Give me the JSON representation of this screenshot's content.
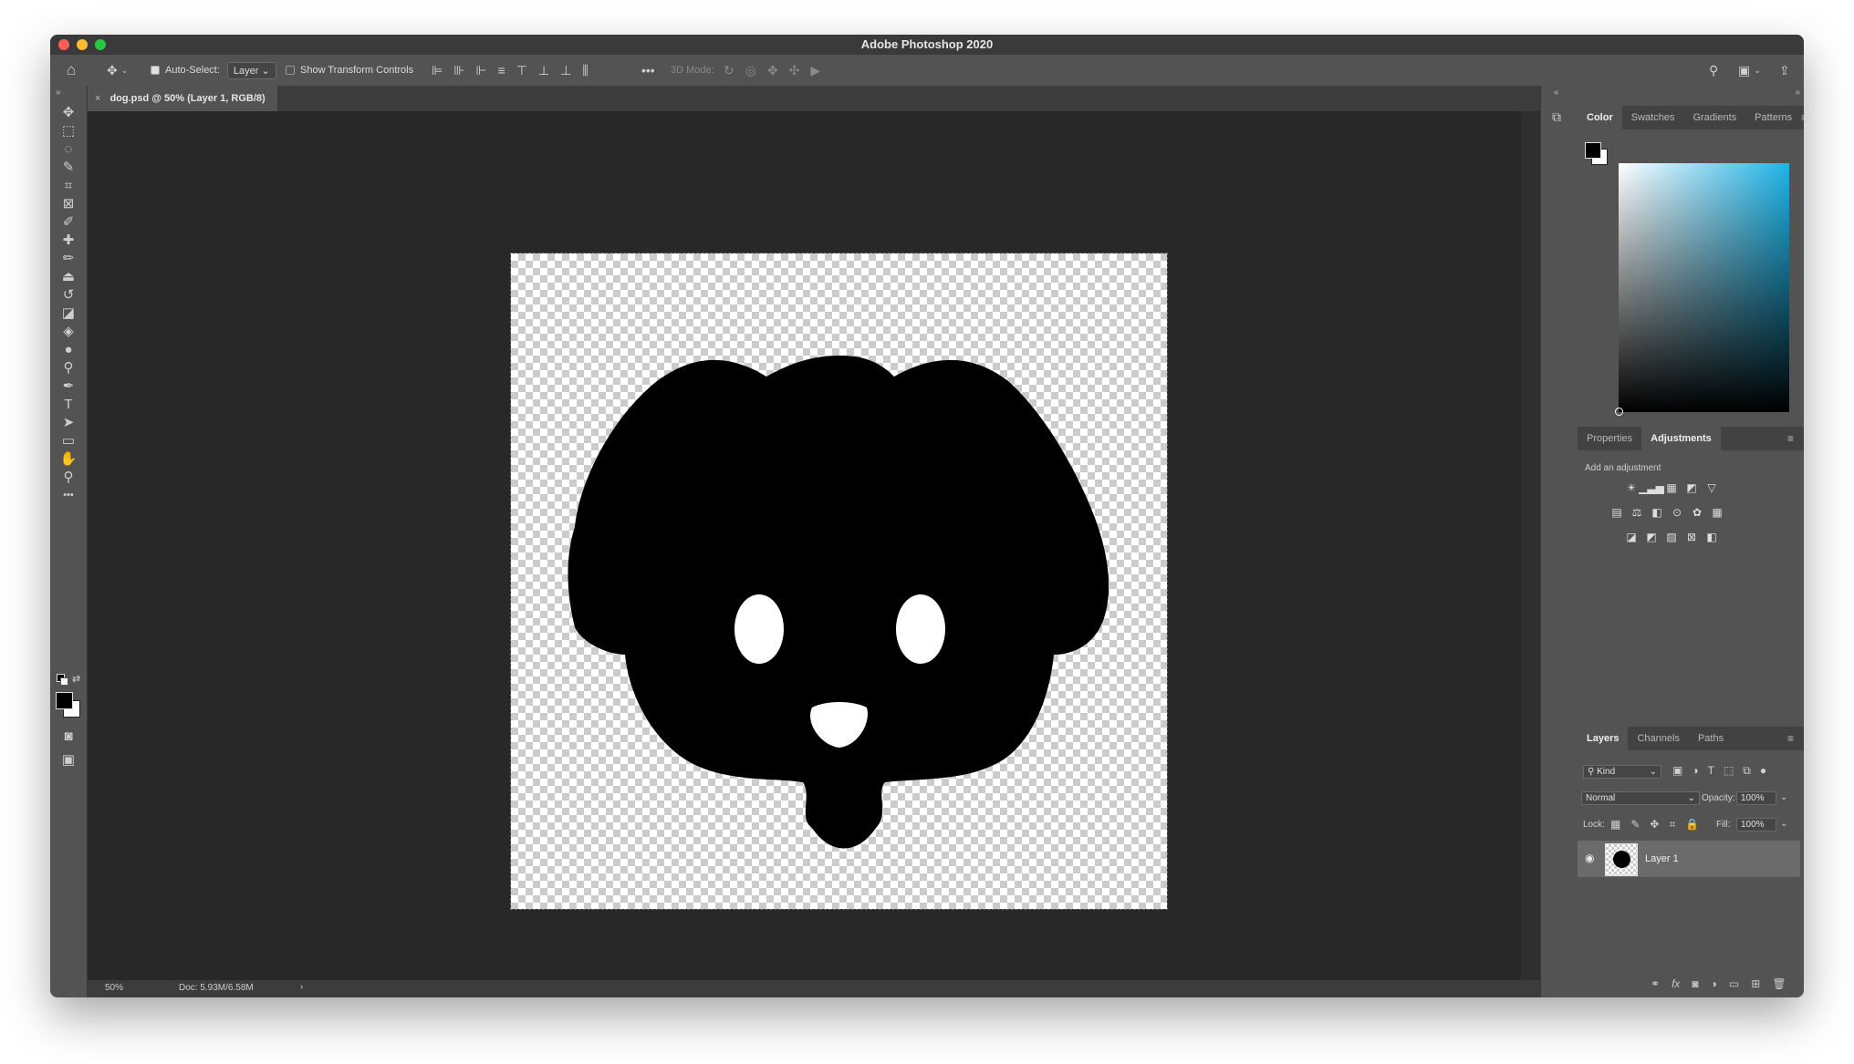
{
  "app": {
    "title": "Adobe Photoshop 2020"
  },
  "options_bar": {
    "auto_select_label": "Auto-Select:",
    "auto_select_checked": true,
    "auto_select_target": "Layer",
    "show_transform_label": "Show Transform Controls",
    "show_transform_checked": false,
    "more_label": "•••",
    "mode_3d_label": "3D Mode:"
  },
  "document": {
    "tab_label": "dog.psd @ 50% (Layer 1, RGB/8)",
    "tab_close": "×",
    "zoom": "50%",
    "doc_size": "Doc: 5.93M/6.58M",
    "status_arrow": "›"
  },
  "toolbar": {
    "tools": [
      {
        "name": "move-tool-icon",
        "glyph": "✥"
      },
      {
        "name": "marquee-tool-icon",
        "glyph": "⬚"
      },
      {
        "name": "lasso-tool-icon",
        "glyph": "◌"
      },
      {
        "name": "quick-selection-tool-icon",
        "glyph": "✎"
      },
      {
        "name": "crop-tool-icon",
        "glyph": "⌗"
      },
      {
        "name": "frame-tool-icon",
        "glyph": "⊠"
      },
      {
        "name": "eyedropper-tool-icon",
        "glyph": "✐"
      },
      {
        "name": "healing-brush-tool-icon",
        "glyph": "✚"
      },
      {
        "name": "brush-tool-icon",
        "glyph": "✏"
      },
      {
        "name": "clone-stamp-tool-icon",
        "glyph": "⏏"
      },
      {
        "name": "history-brush-tool-icon",
        "glyph": "↺"
      },
      {
        "name": "eraser-tool-icon",
        "glyph": "◪"
      },
      {
        "name": "paint-bucket-tool-icon",
        "glyph": "◈"
      },
      {
        "name": "blur-tool-icon",
        "glyph": "●"
      },
      {
        "name": "dodge-tool-icon",
        "glyph": "⚲"
      },
      {
        "name": "pen-tool-icon",
        "glyph": "✒"
      },
      {
        "name": "type-tool-icon",
        "glyph": "T"
      },
      {
        "name": "path-selection-tool-icon",
        "glyph": "➤"
      },
      {
        "name": "rectangle-tool-icon",
        "glyph": "▭"
      },
      {
        "name": "hand-tool-icon",
        "glyph": "✋"
      },
      {
        "name": "zoom-tool-icon",
        "glyph": "⚲"
      },
      {
        "name": "edit-toolbar-icon",
        "glyph": "•••"
      }
    ]
  },
  "color_panel": {
    "tabs": [
      "Color",
      "Swatches",
      "Gradients",
      "Patterns"
    ],
    "active_tab": "Color",
    "hue_color": "#1fb4e8"
  },
  "adjustments_panel": {
    "tabs": [
      "Properties",
      "Adjustments"
    ],
    "active_tab": "Adjustments",
    "hint": "Add an adjustment",
    "row1": [
      "☀",
      "▁▃▅",
      "▦",
      "◩",
      "▽"
    ],
    "row2": [
      "▤",
      "⚖",
      "◧",
      "⊙",
      "✿",
      "▦"
    ],
    "row3": [
      "◪",
      "◩",
      "▨",
      "⊠",
      "◧"
    ]
  },
  "layers_panel": {
    "tabs": [
      "Layers",
      "Channels",
      "Paths"
    ],
    "active_tab": "Layers",
    "filter_kind": "Kind",
    "blend_mode": "Normal",
    "opacity_label": "Opacity:",
    "opacity_value": "100%",
    "lock_label": "Lock:",
    "fill_label": "Fill:",
    "fill_value": "100%",
    "layers": [
      {
        "name": "Layer 1",
        "visible": true
      }
    ]
  },
  "colors": {
    "foreground": "#000000",
    "background": "#ffffff"
  }
}
